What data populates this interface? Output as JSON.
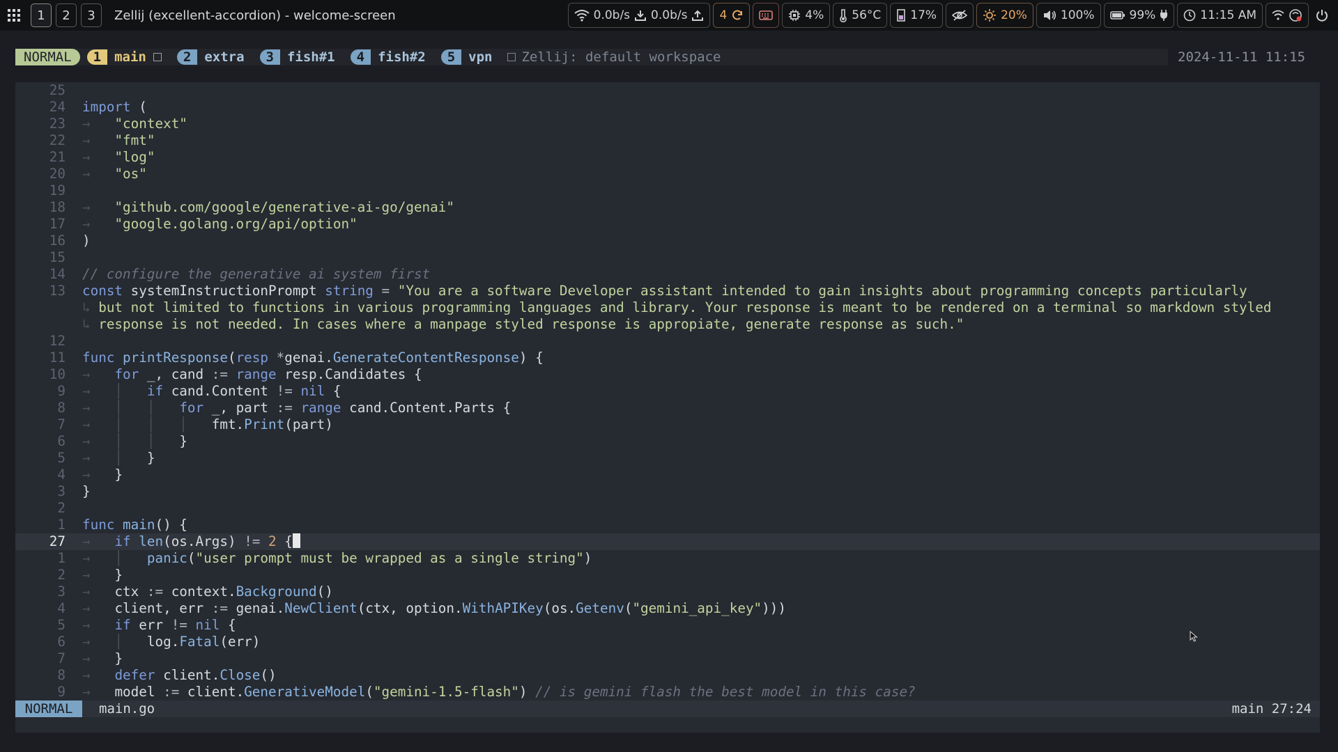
{
  "topbar": {
    "workspaces": [
      "1",
      "2",
      "3"
    ],
    "window_title": "Zellij (excellent-accordion) - welcome-screen",
    "net_down": "0.0b/s",
    "net_up": "0.0b/s",
    "updates": "4",
    "cpu": "4%",
    "temp": "56°C",
    "memory": "17%",
    "brightness": "20%",
    "volume": "100%",
    "battery": "99%",
    "clock": "11:15 AM"
  },
  "tabbar": {
    "mode": "NORMAL",
    "tabs": [
      {
        "num": "1",
        "name": "main"
      },
      {
        "num": "2",
        "name": "extra"
      },
      {
        "num": "3",
        "name": "fish#1"
      },
      {
        "num": "4",
        "name": "fish#2"
      },
      {
        "num": "5",
        "name": "vpn"
      }
    ],
    "workspace": "Zellij: default workspace",
    "datetime": "2024-11-11 11:15"
  },
  "editor": {
    "line_numbers": [
      "25",
      "24",
      "23",
      "22",
      "21",
      "20",
      "19",
      "18",
      "17",
      "16",
      "15",
      "14",
      "13",
      "",
      "",
      "12",
      "11",
      "10",
      "9",
      "8",
      "7",
      "6",
      "5",
      "4",
      "3",
      "2",
      "1",
      "27",
      "1",
      "2",
      "3",
      "4",
      "5",
      "6",
      "7",
      "8",
      "9"
    ],
    "statusline": {
      "mode": "NORMAL",
      "file": "main.go",
      "position": "main 27:24"
    }
  },
  "colors": {
    "background": "#262a31",
    "mode_badge": "#b7c995",
    "active_tab": "#e3c97c",
    "tab": "#7ba3c4",
    "string": "#c0d59e",
    "keyword": "#7e9cd8"
  }
}
